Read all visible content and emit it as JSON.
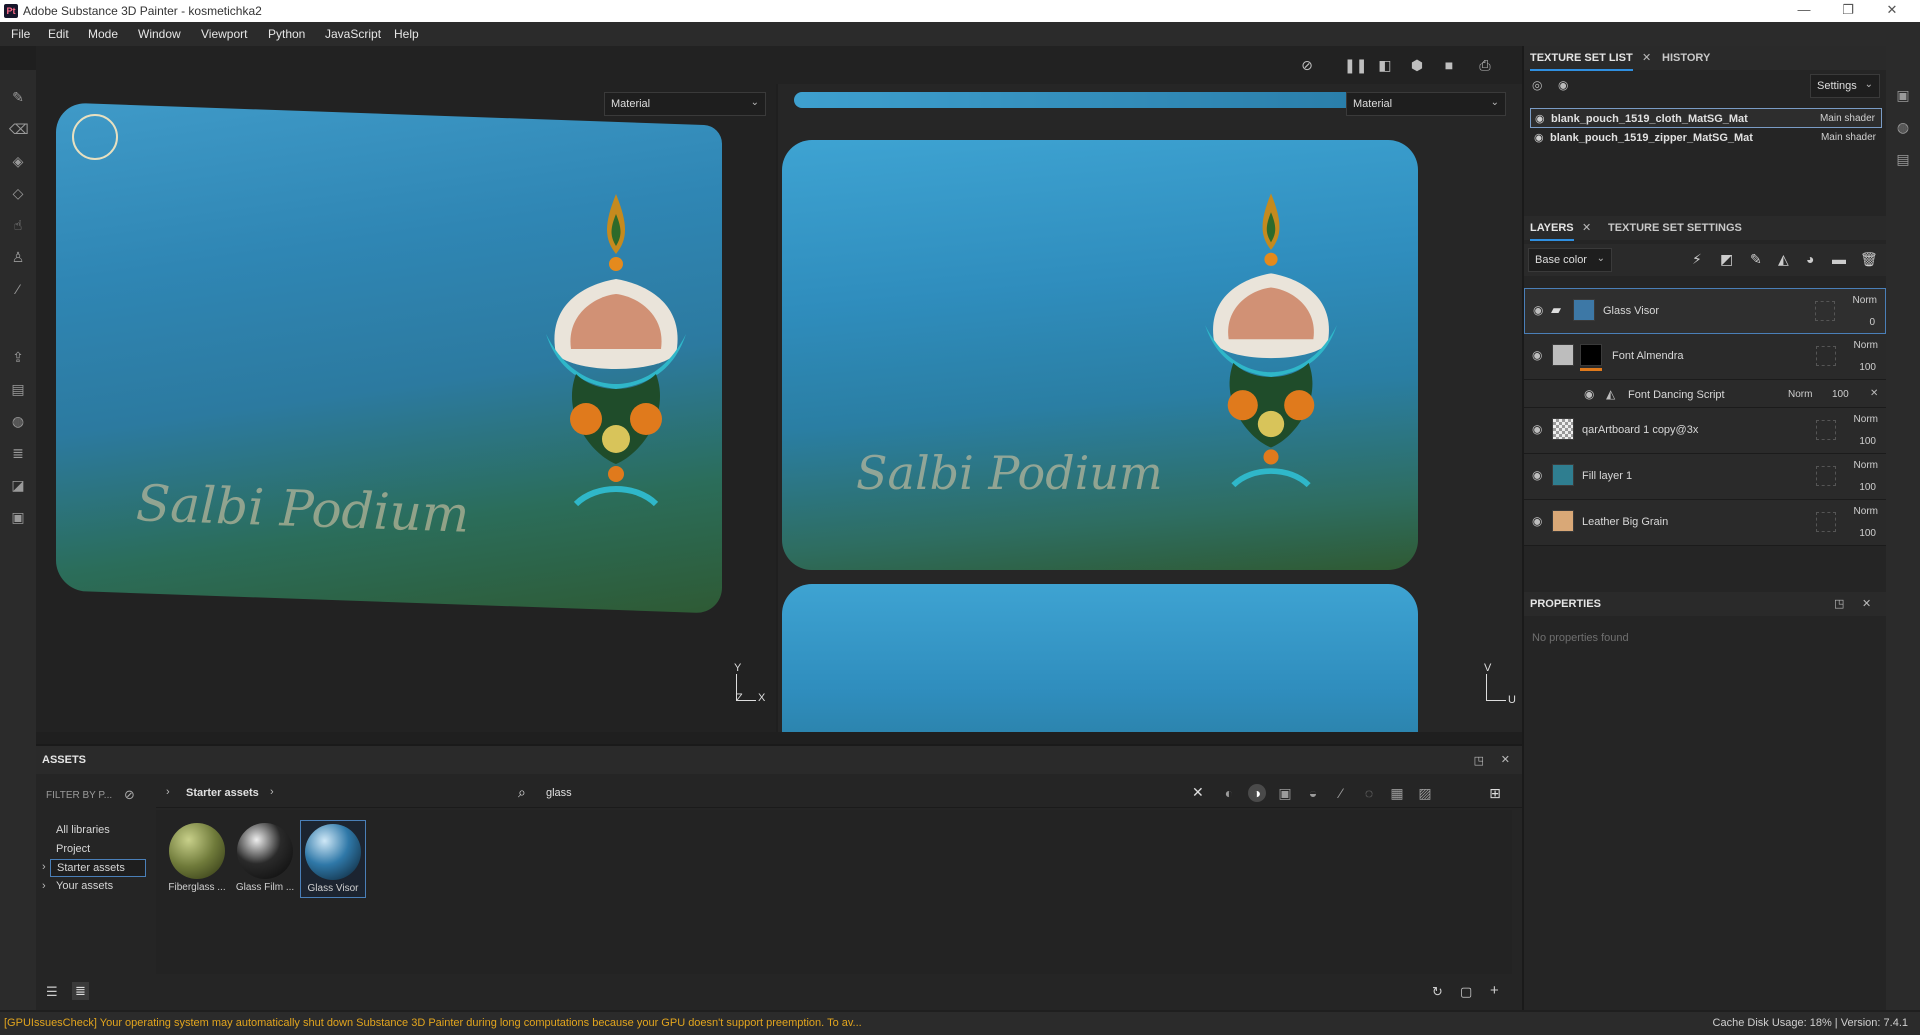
{
  "window": {
    "app_icon": "Pt",
    "title": "Adobe Substance 3D Painter - kosmetichka2",
    "controls": {
      "minimize": "—",
      "maximize": "❐",
      "close": "✕"
    }
  },
  "menu": [
    "File",
    "Edit",
    "Mode",
    "Window",
    "Viewport",
    "Python",
    "JavaScript",
    "Help"
  ],
  "viewport": {
    "left_dropdown": "Material",
    "right_dropdown": "Material",
    "brand_text": "Salbi Podium",
    "axis_3d": {
      "y": "Y",
      "x": "X",
      "z": "Z"
    },
    "axis_2d": {
      "v": "V",
      "u": "U"
    }
  },
  "texture_set_list": {
    "tab_active": "TEXTURE SET LIST",
    "tab_inactive": "HISTORY",
    "settings_label": "Settings",
    "rows": [
      {
        "name": "blank_pouch_1519_cloth_MatSG_Mat",
        "shader": "Main shader"
      },
      {
        "name": "blank_pouch_1519_zipper_MatSG_Mat",
        "shader": "Main shader"
      }
    ]
  },
  "layers": {
    "tab_active": "LAYERS",
    "tab_inactive": "TEXTURE SET SETTINGS",
    "channel": "Base color",
    "rows": [
      {
        "name": "Glass Visor",
        "blend": "Norm",
        "opacity": "0"
      },
      {
        "name": "Font Almendra",
        "blend": "Norm",
        "opacity": "100"
      },
      {
        "name": "Font Dancing Script",
        "blend": "Norm",
        "opacity": "100"
      },
      {
        "name": "qarArtboard 1 copy@3x",
        "blend": "Norm",
        "opacity": "100"
      },
      {
        "name": "Fill layer 1",
        "blend": "Norm",
        "opacity": "100"
      },
      {
        "name": "Leather Big Grain",
        "blend": "Norm",
        "opacity": "100"
      }
    ]
  },
  "properties": {
    "title": "PROPERTIES",
    "empty": "No properties found"
  },
  "assets": {
    "title": "ASSETS",
    "filter_placeholder": "FILTER BY P...",
    "breadcrumb": "Starter assets",
    "search_value": "glass",
    "libraries": [
      "All libraries",
      "Project",
      "Starter assets",
      "Your assets"
    ],
    "items": [
      {
        "name": "Fiberglass ...",
        "color": "#6f7a3a"
      },
      {
        "name": "Glass Film ...",
        "color": "#2a2a2a"
      },
      {
        "name": "Glass Visor",
        "color": "#2f78a8"
      }
    ]
  },
  "status": {
    "message": "[GPUIssuesCheck] Your operating system may automatically shut down Substance 3D Painter during long computations because your GPU doesn't support preemption.  To av...",
    "cache_label": "Cache Disk Usage:",
    "cache_value": "18% | Version: 7.4.1"
  },
  "colors": {
    "accent": "#2f8fe0",
    "warning": "#e2a51e",
    "pouch_blue": "#2f86b4"
  }
}
